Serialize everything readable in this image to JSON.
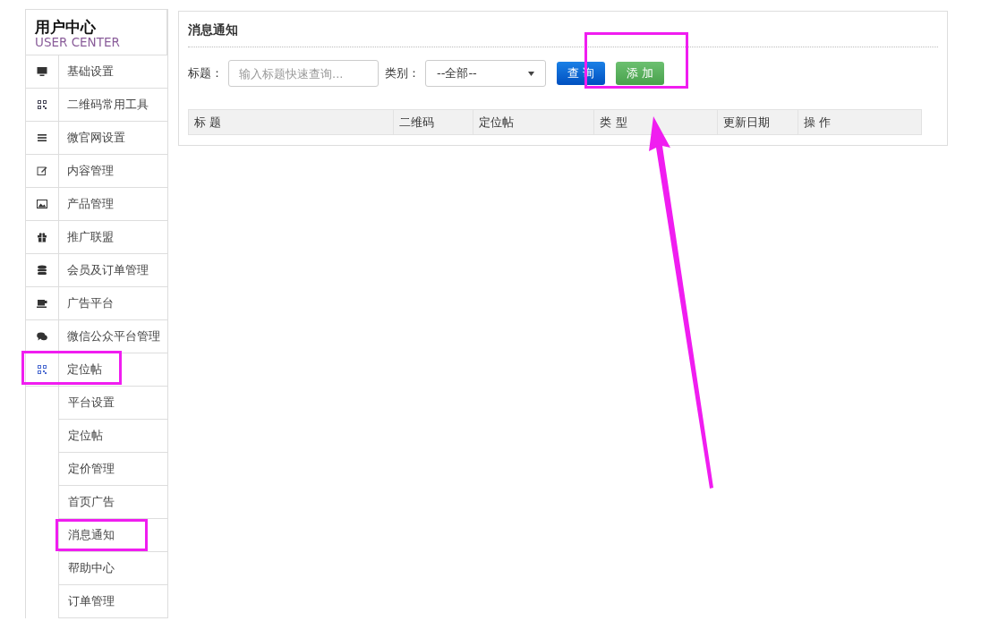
{
  "sidebar": {
    "title": "用户中心",
    "subtitle": "USER CENTER",
    "items": [
      {
        "label": "基础设置",
        "highlighted": false
      },
      {
        "label": "二维码常用工具",
        "highlighted": false
      },
      {
        "label": "微官网设置",
        "highlighted": false
      },
      {
        "label": "内容管理",
        "highlighted": false
      },
      {
        "label": "产品管理",
        "highlighted": false
      },
      {
        "label": "推广联盟",
        "highlighted": false
      },
      {
        "label": "会员及订单管理",
        "highlighted": false
      },
      {
        "label": "广告平台",
        "highlighted": false
      },
      {
        "label": "微信公众平台管理",
        "highlighted": false
      },
      {
        "label": "定位帖",
        "highlighted": true,
        "expanded": true,
        "children": [
          {
            "label": "平台设置",
            "highlighted": false
          },
          {
            "label": "定位帖",
            "highlighted": false
          },
          {
            "label": "定价管理",
            "highlighted": false
          },
          {
            "label": "首页广告",
            "highlighted": false
          },
          {
            "label": "消息通知",
            "highlighted": true
          },
          {
            "label": "帮助中心",
            "highlighted": false
          },
          {
            "label": "订单管理",
            "highlighted": false
          }
        ]
      }
    ]
  },
  "panel": {
    "title": "消息通知",
    "filters": {
      "title_label": "标题：",
      "title_placeholder": "输入标题快速查询...",
      "category_label": "类别：",
      "category_value": "--全部--"
    },
    "buttons": [
      {
        "label": "查 询",
        "kind": "primary",
        "highlighted": false
      },
      {
        "label": "添 加",
        "kind": "success",
        "highlighted": true,
        "arrow": true
      }
    ],
    "table": {
      "columns": [
        "标 题",
        "二维码",
        "定位帖",
        "类 型",
        "更新日期",
        "操 作"
      ]
    }
  }
}
